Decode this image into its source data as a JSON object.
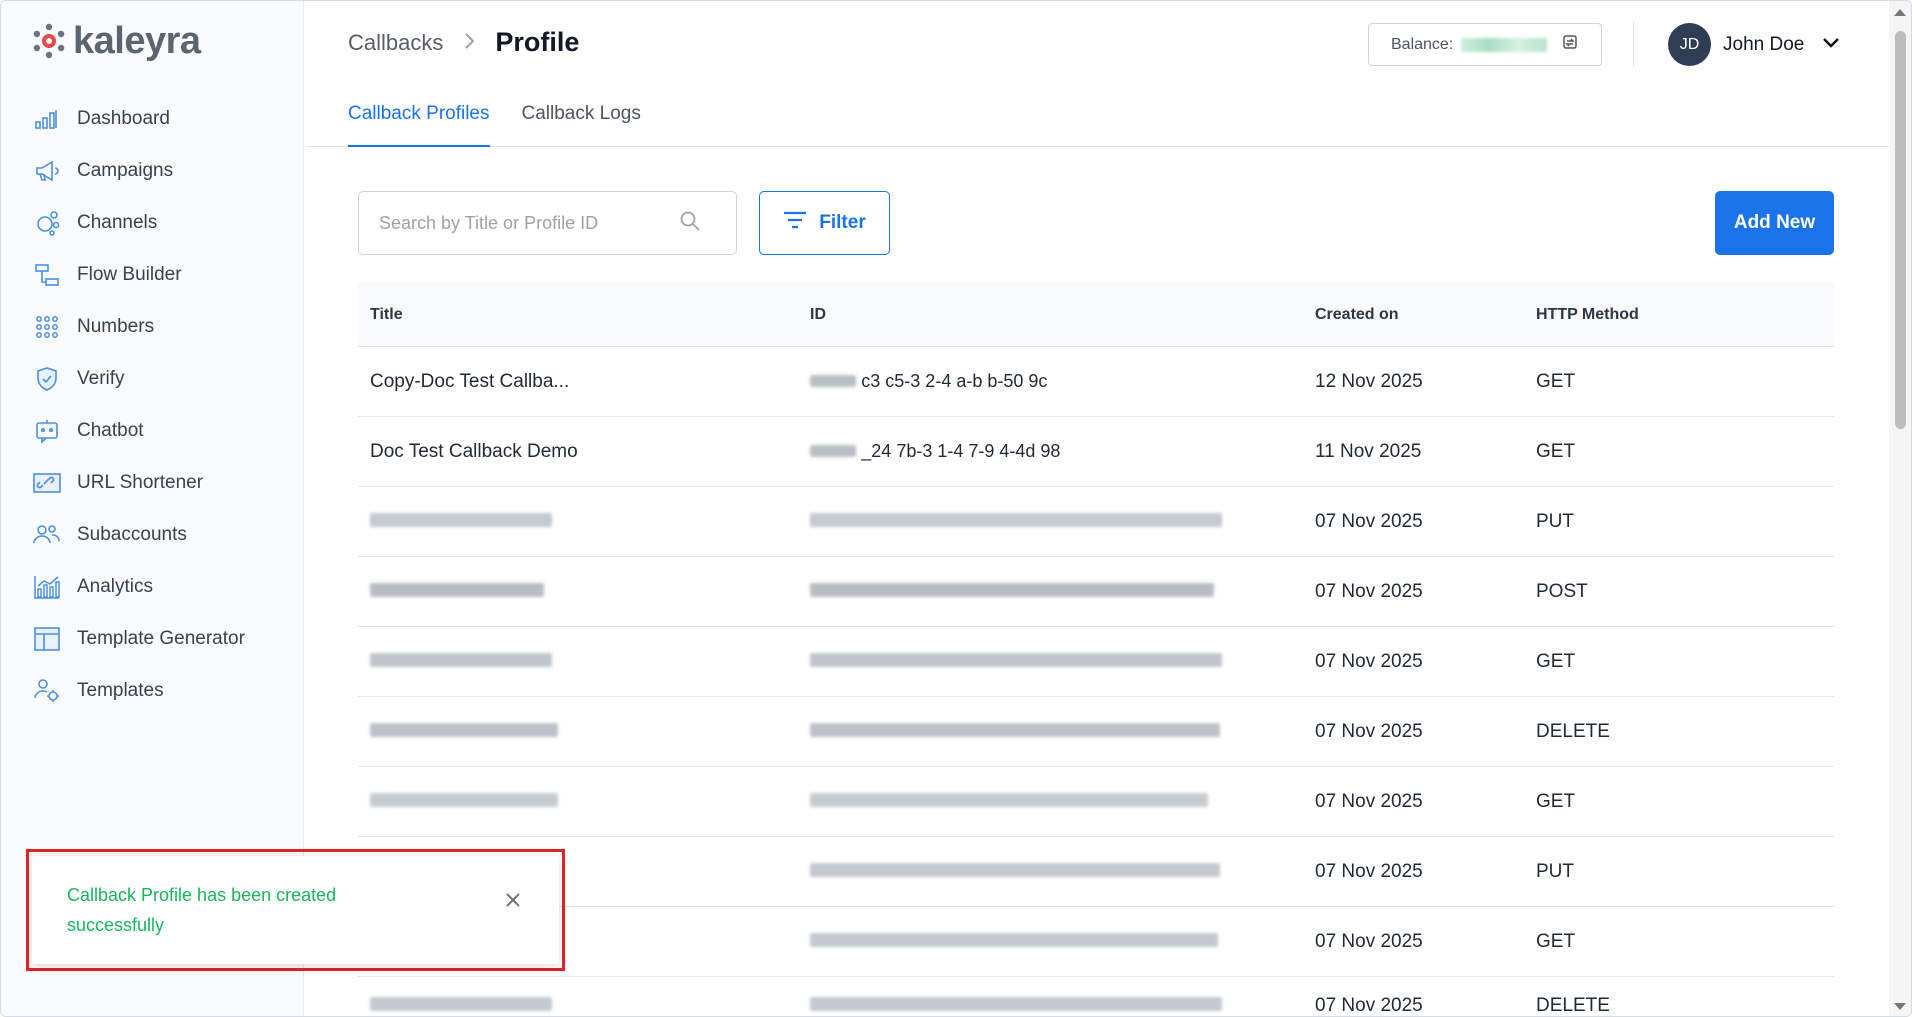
{
  "brand": {
    "name": "kaleyra",
    "accent": "#1a73e8"
  },
  "sidebar": {
    "items": [
      {
        "label": "Dashboard",
        "icon": "bar-chart-icon"
      },
      {
        "label": "Campaigns",
        "icon": "megaphone-icon"
      },
      {
        "label": "Channels",
        "icon": "channels-icon"
      },
      {
        "label": "Flow Builder",
        "icon": "flow-icon"
      },
      {
        "label": "Numbers",
        "icon": "dialpad-icon"
      },
      {
        "label": "Verify",
        "icon": "shield-check-icon"
      },
      {
        "label": "Chatbot",
        "icon": "chatbot-icon"
      },
      {
        "label": "URL Shortener",
        "icon": "link-icon"
      },
      {
        "label": "Subaccounts",
        "icon": "users-icon"
      },
      {
        "label": "Analytics",
        "icon": "analytics-icon"
      },
      {
        "label": "Template Generator",
        "icon": "layout-icon"
      },
      {
        "label": "Templates",
        "icon": "templates-icon"
      }
    ]
  },
  "header": {
    "breadcrumb": {
      "parent": "Callbacks",
      "separator": ">",
      "current": "Profile"
    },
    "tabs": [
      {
        "label": "Callback Profiles",
        "active": true
      },
      {
        "label": "Callback Logs",
        "active": false
      }
    ],
    "balance_label": "Balance:",
    "user": {
      "initials": "JD",
      "name": "John Doe"
    }
  },
  "toolbar": {
    "search_placeholder": "Search by Title or Profile ID",
    "filter_label": "Filter",
    "add_label": "Add New"
  },
  "table": {
    "columns": [
      "Title",
      "ID",
      "Created on",
      "HTTP Method"
    ],
    "rows": [
      {
        "title": "Copy-Doc Test Callba...",
        "id": "c3  c5-3  2-4  a-b  b-50  9c",
        "created": "12 Nov 2025",
        "method": "GET",
        "redacted": false
      },
      {
        "title": "Doc Test Callback Demo",
        "id": "_24  7b-3  1-4  7-9  4-4d  98",
        "created": "11 Nov 2025",
        "method": "GET",
        "redacted": false
      },
      {
        "title": "",
        "id": "",
        "created": "07 Nov 2025",
        "method": "PUT",
        "redacted": true
      },
      {
        "title": "",
        "id": "",
        "created": "07 Nov 2025",
        "method": "POST",
        "redacted": true
      },
      {
        "title": "",
        "id": "",
        "created": "07 Nov 2025",
        "method": "GET",
        "redacted": true
      },
      {
        "title": "",
        "id": "",
        "created": "07 Nov 2025",
        "method": "DELETE",
        "redacted": true
      },
      {
        "title": "",
        "id": "",
        "created": "07 Nov 2025",
        "method": "GET",
        "redacted": true
      },
      {
        "title": "",
        "id": "",
        "created": "07 Nov 2025",
        "method": "PUT",
        "redacted": true
      },
      {
        "title": "",
        "id": "",
        "created": "07 Nov 2025",
        "method": "GET",
        "redacted": true
      },
      {
        "title": "",
        "id": "",
        "created": "07 Nov 2025",
        "method": "DELETE",
        "redacted": true
      }
    ]
  },
  "toast": {
    "message": "Callback Profile has been created successfully",
    "color": "#18b55b",
    "highlight_color": "#e02424"
  }
}
